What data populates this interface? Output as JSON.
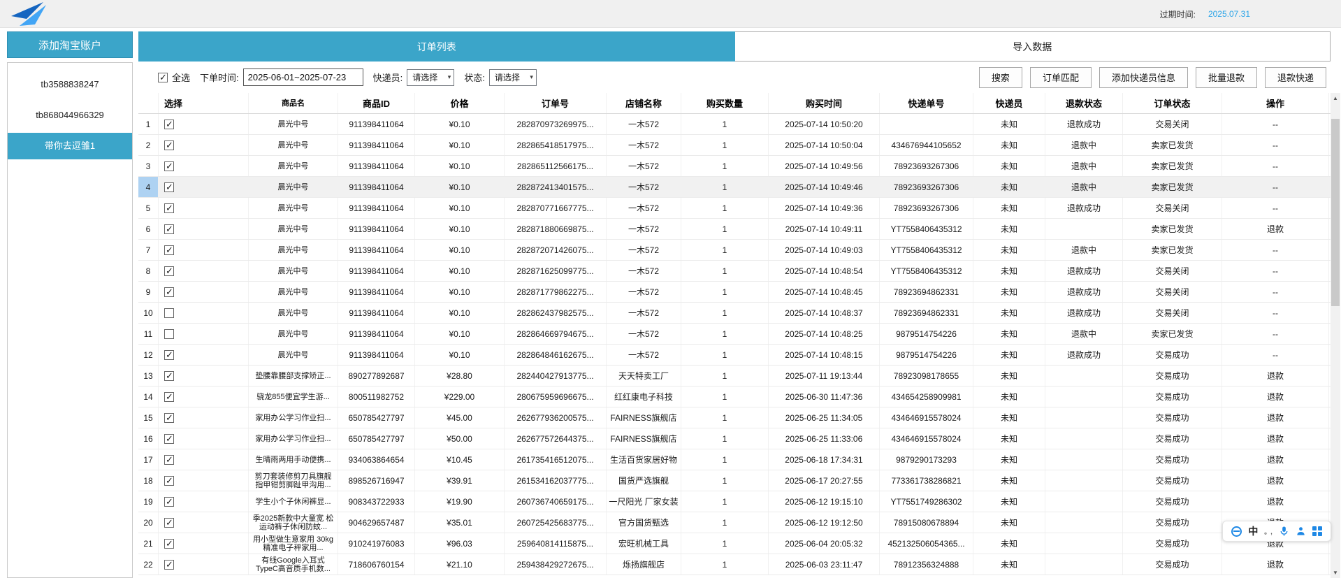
{
  "colors": {
    "accent": "#3ba5c9",
    "expiry_value": "#2aa4e8",
    "ime_icon": "#1e88e5",
    "row_highlight": "#aed2f2"
  },
  "topbar": {
    "expiry_label": "过期时间:",
    "expiry_value": "2025.07.31"
  },
  "sidebar": {
    "add_account_button": "添加淘宝账户",
    "accounts": [
      {
        "name": "tb3588838247",
        "selected": false
      },
      {
        "name": "tb868044966329",
        "selected": false
      },
      {
        "name": "带你去逗雏1",
        "selected": true
      }
    ]
  },
  "tabs": [
    {
      "label": "订单列表",
      "active": true
    },
    {
      "label": "导入数据",
      "active": false
    }
  ],
  "toolbar": {
    "select_all_label": "全选",
    "order_time_label": "下单时间:",
    "order_time_value": "2025-06-01~2025-07-23",
    "courier_label": "快递员:",
    "courier_value": "请选择",
    "status_label": "状态:",
    "status_value": "请选择",
    "buttons": [
      "搜索",
      "订单匹配",
      "添加快递员信息",
      "批量退款",
      "退款快递"
    ]
  },
  "table": {
    "columns": [
      "",
      "选择",
      "商品名",
      "商品ID",
      "价格",
      "订单号",
      "店铺名称",
      "购买数量",
      "购买时间",
      "快递单号",
      "快递员",
      "退款状态",
      "订单状态",
      "操作"
    ],
    "rows": [
      {
        "num": 1,
        "checked": true,
        "product": "晨光中号",
        "product_id": "911398411064",
        "price": "¥0.10",
        "order_no": "282870973269975...",
        "shop": "一木572",
        "qty": "1",
        "buy_time": "2025-07-14 10:50:20",
        "tracking_no": "",
        "courier": "未知",
        "refund_status": "退款成功",
        "order_status": "交易关闭",
        "action": "--"
      },
      {
        "num": 2,
        "checked": true,
        "product": "晨光中号",
        "product_id": "911398411064",
        "price": "¥0.10",
        "order_no": "282865418517975...",
        "shop": "一木572",
        "qty": "1",
        "buy_time": "2025-07-14 10:50:04",
        "tracking_no": "434676944105652",
        "courier": "未知",
        "refund_status": "退款中",
        "order_status": "卖家已发货",
        "action": "--"
      },
      {
        "num": 3,
        "checked": true,
        "product": "晨光中号",
        "product_id": "911398411064",
        "price": "¥0.10",
        "order_no": "282865112566175...",
        "shop": "一木572",
        "qty": "1",
        "buy_time": "2025-07-14 10:49:56",
        "tracking_no": "78923693267306",
        "courier": "未知",
        "refund_status": "退款中",
        "order_status": "卖家已发货",
        "action": "--"
      },
      {
        "num": 4,
        "checked": true,
        "highlighted": true,
        "product": "晨光中号",
        "product_id": "911398411064",
        "price": "¥0.10",
        "order_no": "282872413401575...",
        "shop": "一木572",
        "qty": "1",
        "buy_time": "2025-07-14 10:49:46",
        "tracking_no": "78923693267306",
        "courier": "未知",
        "refund_status": "退款中",
        "order_status": "卖家已发货",
        "action": "--"
      },
      {
        "num": 5,
        "checked": true,
        "product": "晨光中号",
        "product_id": "911398411064",
        "price": "¥0.10",
        "order_no": "282870771667775...",
        "shop": "一木572",
        "qty": "1",
        "buy_time": "2025-07-14 10:49:36",
        "tracking_no": "78923693267306",
        "courier": "未知",
        "refund_status": "退款成功",
        "order_status": "交易关闭",
        "action": "--"
      },
      {
        "num": 6,
        "checked": true,
        "product": "晨光中号",
        "product_id": "911398411064",
        "price": "¥0.10",
        "order_no": "282871880669875...",
        "shop": "一木572",
        "qty": "1",
        "buy_time": "2025-07-14 10:49:11",
        "tracking_no": "YT7558406435312",
        "courier": "未知",
        "refund_status": "",
        "order_status": "卖家已发货",
        "action": "退款"
      },
      {
        "num": 7,
        "checked": true,
        "product": "晨光中号",
        "product_id": "911398411064",
        "price": "¥0.10",
        "order_no": "282872071426075...",
        "shop": "一木572",
        "qty": "1",
        "buy_time": "2025-07-14 10:49:03",
        "tracking_no": "YT7558406435312",
        "courier": "未知",
        "refund_status": "退款中",
        "order_status": "卖家已发货",
        "action": "--"
      },
      {
        "num": 8,
        "checked": true,
        "product": "晨光中号",
        "product_id": "911398411064",
        "price": "¥0.10",
        "order_no": "282871625099775...",
        "shop": "一木572",
        "qty": "1",
        "buy_time": "2025-07-14 10:48:54",
        "tracking_no": "YT7558406435312",
        "courier": "未知",
        "refund_status": "退款成功",
        "order_status": "交易关闭",
        "action": "--"
      },
      {
        "num": 9,
        "checked": true,
        "product": "晨光中号",
        "product_id": "911398411064",
        "price": "¥0.10",
        "order_no": "282871779862275...",
        "shop": "一木572",
        "qty": "1",
        "buy_time": "2025-07-14 10:48:45",
        "tracking_no": "78923694862331",
        "courier": "未知",
        "refund_status": "退款成功",
        "order_status": "交易关闭",
        "action": "--"
      },
      {
        "num": 10,
        "checked": false,
        "product": "晨光中号",
        "product_id": "911398411064",
        "price": "¥0.10",
        "order_no": "282862437982575...",
        "shop": "一木572",
        "qty": "1",
        "buy_time": "2025-07-14 10:48:37",
        "tracking_no": "78923694862331",
        "courier": "未知",
        "refund_status": "退款成功",
        "order_status": "交易关闭",
        "action": "--"
      },
      {
        "num": 11,
        "checked": false,
        "product": "晨光中号",
        "product_id": "911398411064",
        "price": "¥0.10",
        "order_no": "282864669794675...",
        "shop": "一木572",
        "qty": "1",
        "buy_time": "2025-07-14 10:48:25",
        "tracking_no": "9879514754226",
        "courier": "未知",
        "refund_status": "退款中",
        "order_status": "卖家已发货",
        "action": "--"
      },
      {
        "num": 12,
        "checked": true,
        "product": "晨光中号",
        "product_id": "911398411064",
        "price": "¥0.10",
        "order_no": "282864846162675...",
        "shop": "一木572",
        "qty": "1",
        "buy_time": "2025-07-14 10:48:15",
        "tracking_no": "9879514754226",
        "courier": "未知",
        "refund_status": "退款成功",
        "order_status": "交易成功",
        "action": "--"
      },
      {
        "num": 13,
        "checked": true,
        "product": "垫腰靠腰部支撑矫正...",
        "product_id": "890277892687",
        "price": "¥28.80",
        "order_no": "282440427913775...",
        "shop": "天天特卖工厂",
        "qty": "1",
        "buy_time": "2025-07-11 19:13:44",
        "tracking_no": "78923098178655",
        "courier": "未知",
        "refund_status": "",
        "order_status": "交易成功",
        "action": "退款"
      },
      {
        "num": 14,
        "checked": true,
        "product": "骁龙855便宜学生游...",
        "product_id": "800511982752",
        "price": "¥229.00",
        "order_no": "280675959696675...",
        "shop": "红红康电子科技",
        "qty": "1",
        "buy_time": "2025-06-30 11:47:36",
        "tracking_no": "434654258909981",
        "courier": "未知",
        "refund_status": "",
        "order_status": "交易成功",
        "action": "退款"
      },
      {
        "num": 15,
        "checked": true,
        "product": "家用办公学习作业扫...",
        "product_id": "650785427797",
        "price": "¥45.00",
        "order_no": "262677936200575...",
        "shop": "FAIRNESS旗舰店",
        "qty": "1",
        "buy_time": "2025-06-25 11:34:05",
        "tracking_no": "434646915578024",
        "courier": "未知",
        "refund_status": "",
        "order_status": "交易成功",
        "action": "退款"
      },
      {
        "num": 16,
        "checked": true,
        "product": "家用办公学习作业扫...",
        "product_id": "650785427797",
        "price": "¥50.00",
        "order_no": "262677572644375...",
        "shop": "FAIRNESS旗舰店",
        "qty": "1",
        "buy_time": "2025-06-25 11:33:06",
        "tracking_no": "434646915578024",
        "courier": "未知",
        "refund_status": "",
        "order_status": "交易成功",
        "action": "退款"
      },
      {
        "num": 17,
        "checked": true,
        "product": "生晴雨两用手动便携...",
        "product_id": "934063864654",
        "price": "¥10.45",
        "order_no": "261735416512075...",
        "shop": "生活百货家居好物",
        "qty": "1",
        "buy_time": "2025-06-18 17:34:31",
        "tracking_no": "9879290173293",
        "courier": "未知",
        "refund_status": "",
        "order_status": "交易成功",
        "action": "退款"
      },
      {
        "num": 18,
        "checked": true,
        "product": "剪刀套装修剪刀具旗舰 指甲钳剪脚趾甲沟用...",
        "product_id": "898526716947",
        "price": "¥39.91",
        "order_no": "261534162037775...",
        "shop": "国货严选旗舰",
        "qty": "1",
        "buy_time": "2025-06-17 20:27:55",
        "tracking_no": "773361738286821",
        "courier": "未知",
        "refund_status": "",
        "order_status": "交易成功",
        "action": "退款"
      },
      {
        "num": 19,
        "checked": true,
        "product": "学生小个子休闲裤显...",
        "product_id": "908343722933",
        "price": "¥19.90",
        "order_no": "260736740659175...",
        "shop": "一尺阳光 厂家女装",
        "qty": "1",
        "buy_time": "2025-06-12 19:15:10",
        "tracking_no": "YT7551749286302",
        "courier": "未知",
        "refund_status": "",
        "order_status": "交易成功",
        "action": "退款"
      },
      {
        "num": 20,
        "checked": true,
        "product": "季2025新款中大童宽 松运动裤子休闲防蚊...",
        "product_id": "904629657487",
        "price": "¥35.01",
        "order_no": "260725425683775...",
        "shop": "官方国货甄选",
        "qty": "1",
        "buy_time": "2025-06-12 19:12:50",
        "tracking_no": "78915080678894",
        "courier": "未知",
        "refund_status": "",
        "order_status": "交易成功",
        "action": "退款"
      },
      {
        "num": 21,
        "checked": true,
        "product": "用小型做生意家用 30kg精准电子秤家用...",
        "product_id": "910241976083",
        "price": "¥96.03",
        "order_no": "259640814115875...",
        "shop": "宏旺机械工具",
        "qty": "1",
        "buy_time": "2025-06-04 20:05:32",
        "tracking_no": "452132506054365...",
        "courier": "未知",
        "refund_status": "",
        "order_status": "交易成功",
        "action": "退款"
      },
      {
        "num": 22,
        "checked": true,
        "product": "有线Google入耳式 TypeC高音质手机数...",
        "product_id": "718606760154",
        "price": "¥21.10",
        "order_no": "259438429272675...",
        "shop": "烁扬旗舰店",
        "qty": "1",
        "buy_time": "2025-06-03 23:11:47",
        "tracking_no": "78912356324888",
        "courier": "未知",
        "refund_status": "",
        "order_status": "交易成功",
        "action": "退款"
      }
    ]
  },
  "ime": {
    "language": "中",
    "punctuation": "。,"
  }
}
